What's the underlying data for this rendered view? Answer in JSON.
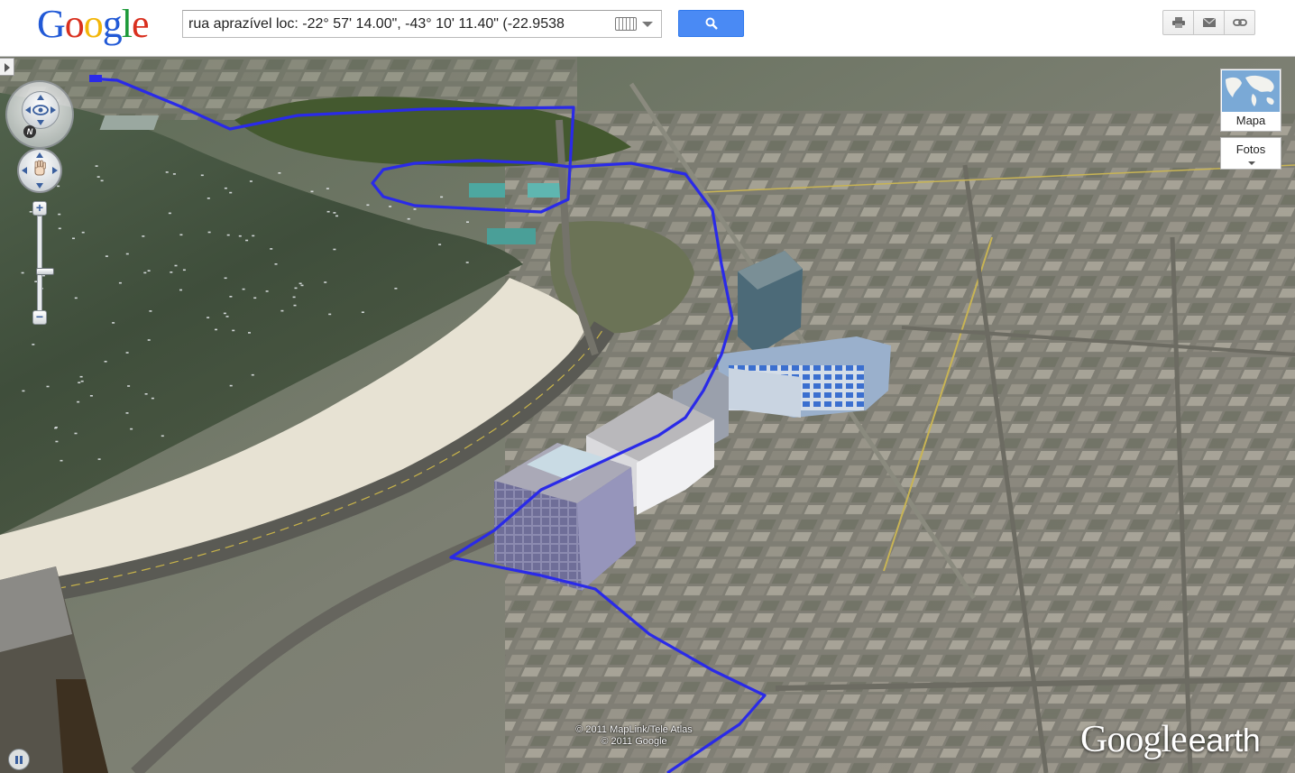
{
  "header": {
    "logo_letters": [
      {
        "ch": "G",
        "color": "#2159d6"
      },
      {
        "ch": "o",
        "color": "#d9301f"
      },
      {
        "ch": "o",
        "color": "#f3b609"
      },
      {
        "ch": "g",
        "color": "#2159d6"
      },
      {
        "ch": "l",
        "color": "#1d9a3a"
      },
      {
        "ch": "e",
        "color": "#d9301f"
      }
    ],
    "search_value": "rua aprazível loc: -22° 57' 14.00\", -43° 10' 11.40\" (-22.9538",
    "search_icon": "magnifier-icon",
    "tools": [
      {
        "name": "print-icon"
      },
      {
        "name": "email-icon"
      },
      {
        "name": "link-icon"
      }
    ]
  },
  "earth": {
    "map_type_label": "Mapa",
    "photos_label": "Fotos",
    "compass_letter": "N",
    "zoom_in": "+",
    "zoom_out": "−",
    "attribution_line1": "© 2011 MapLink/Tele Atlas",
    "attribution_line2": "© 2011 Google",
    "brand_google": "Google",
    "brand_earth": "earth",
    "route_color": "#2a2ae8",
    "water_color": "#3b4b38",
    "beach_color": "#e9e4d7"
  }
}
